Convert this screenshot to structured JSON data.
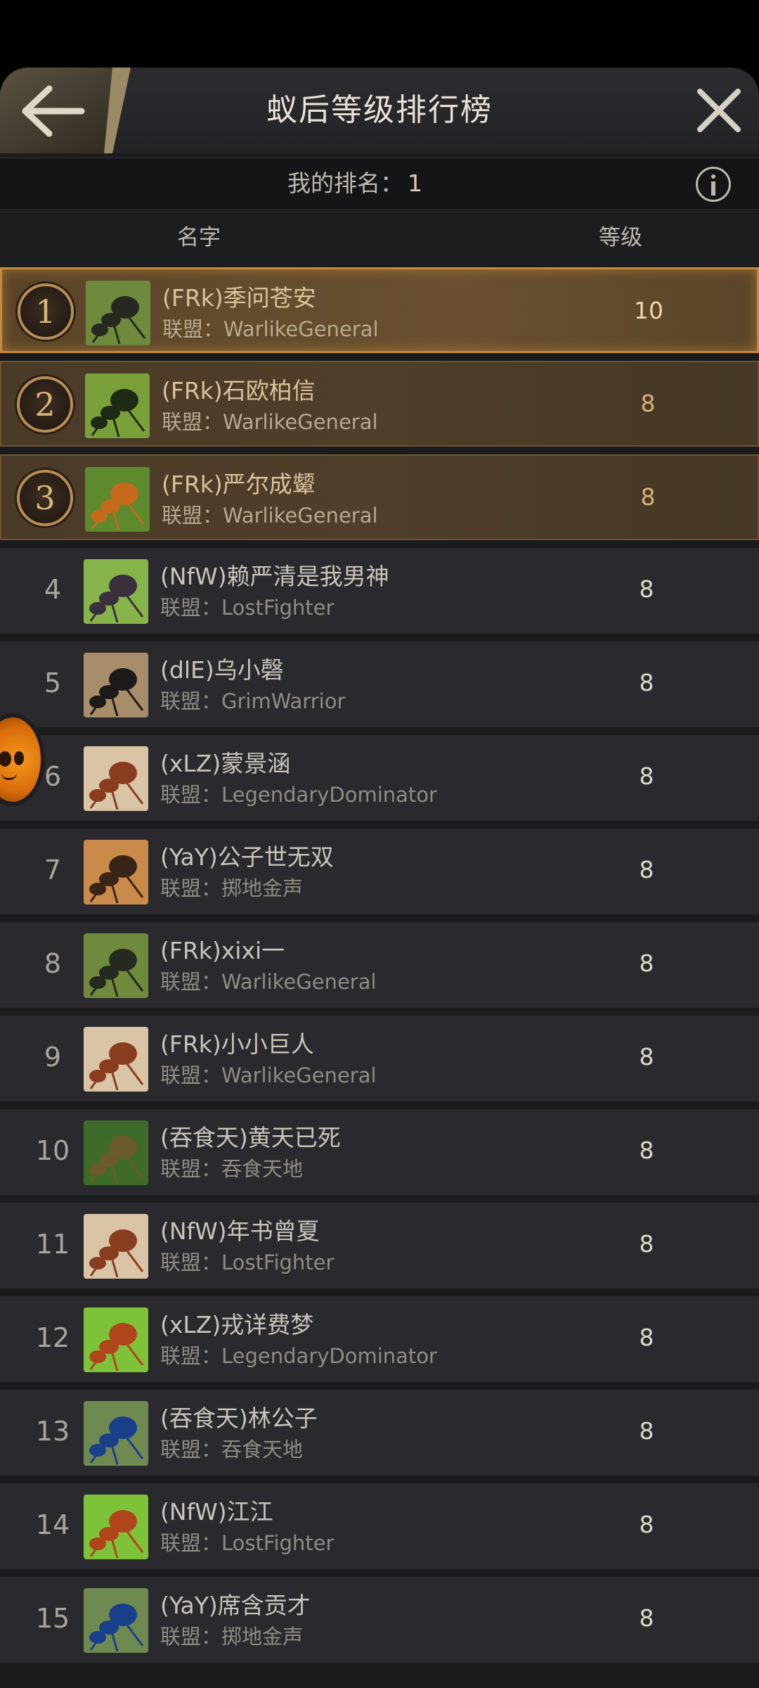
{
  "header": {
    "title": "蚁后等级排行榜"
  },
  "my_rank": {
    "label": "我的排名：",
    "value": "1"
  },
  "columns": {
    "name": "名字",
    "level": "等级"
  },
  "alliance_label": "联盟：",
  "rows": [
    {
      "rank": "1",
      "name": "(FRk)季问苍安",
      "alliance": "WarlikeGeneral",
      "level": "10",
      "avatar": "black-ant-avatar"
    },
    {
      "rank": "2",
      "name": "(FRk)石欧柏信",
      "alliance": "WarlikeGeneral",
      "level": "8",
      "avatar": "spiky-ant-avatar"
    },
    {
      "rank": "3",
      "name": "(FRk)严尔成颦",
      "alliance": "WarlikeGeneral",
      "level": "8",
      "avatar": "orange-ant-avatar"
    },
    {
      "rank": "4",
      "name": "(NfW)赖严清是我男神",
      "alliance": "LostFighter",
      "level": "8",
      "avatar": "purple-ant-avatar"
    },
    {
      "rank": "5",
      "name": "(dlE)乌小磬",
      "alliance": "GrimWarrior",
      "level": "8",
      "avatar": "horned-ant-avatar"
    },
    {
      "rank": "6",
      "name": "(xLZ)蒙景涵",
      "alliance": "LegendaryDominator",
      "level": "8",
      "avatar": "red-ant-avatar"
    },
    {
      "rank": "7",
      "name": "(YaY)公子世无双",
      "alliance": "掷地金声",
      "level": "8",
      "avatar": "bullet-ant-avatar"
    },
    {
      "rank": "8",
      "name": "(FRk)xixi一",
      "alliance": "WarlikeGeneral",
      "level": "8",
      "avatar": "black-ant-avatar"
    },
    {
      "rank": "9",
      "name": "(FRk)小小巨人",
      "alliance": "WarlikeGeneral",
      "level": "8",
      "avatar": "red-ant-avatar"
    },
    {
      "rank": "10",
      "name": "(吞食天)黄天已死",
      "alliance": "吞食天地",
      "level": "8",
      "avatar": "leaf-ant-avatar"
    },
    {
      "rank": "11",
      "name": "(NfW)年书曾夏",
      "alliance": "LostFighter",
      "level": "8",
      "avatar": "red-ant-avatar"
    },
    {
      "rank": "12",
      "name": "(xLZ)戎详费梦",
      "alliance": "LegendaryDominator",
      "level": "8",
      "avatar": "green-bg-ant-avatar"
    },
    {
      "rank": "13",
      "name": "(吞食天)林公子",
      "alliance": "吞食天地",
      "level": "8",
      "avatar": "blue-ant-avatar"
    },
    {
      "rank": "14",
      "name": "(NfW)江江",
      "alliance": "LostFighter",
      "level": "8",
      "avatar": "green-bg-ant-avatar"
    },
    {
      "rank": "15",
      "name": "(YaY)席含贡才",
      "alliance": "掷地金声",
      "level": "8",
      "avatar": "blue-ant-avatar"
    }
  ],
  "icons": {
    "back": "back-arrow-icon",
    "close": "close-icon",
    "info": "info-icon"
  },
  "colors": {
    "gold_border": "#c58a3a",
    "top_row_bg": "#4e3e2a",
    "row_bg": "#2a2a2e",
    "panel_bg": "#1b1b1e"
  }
}
